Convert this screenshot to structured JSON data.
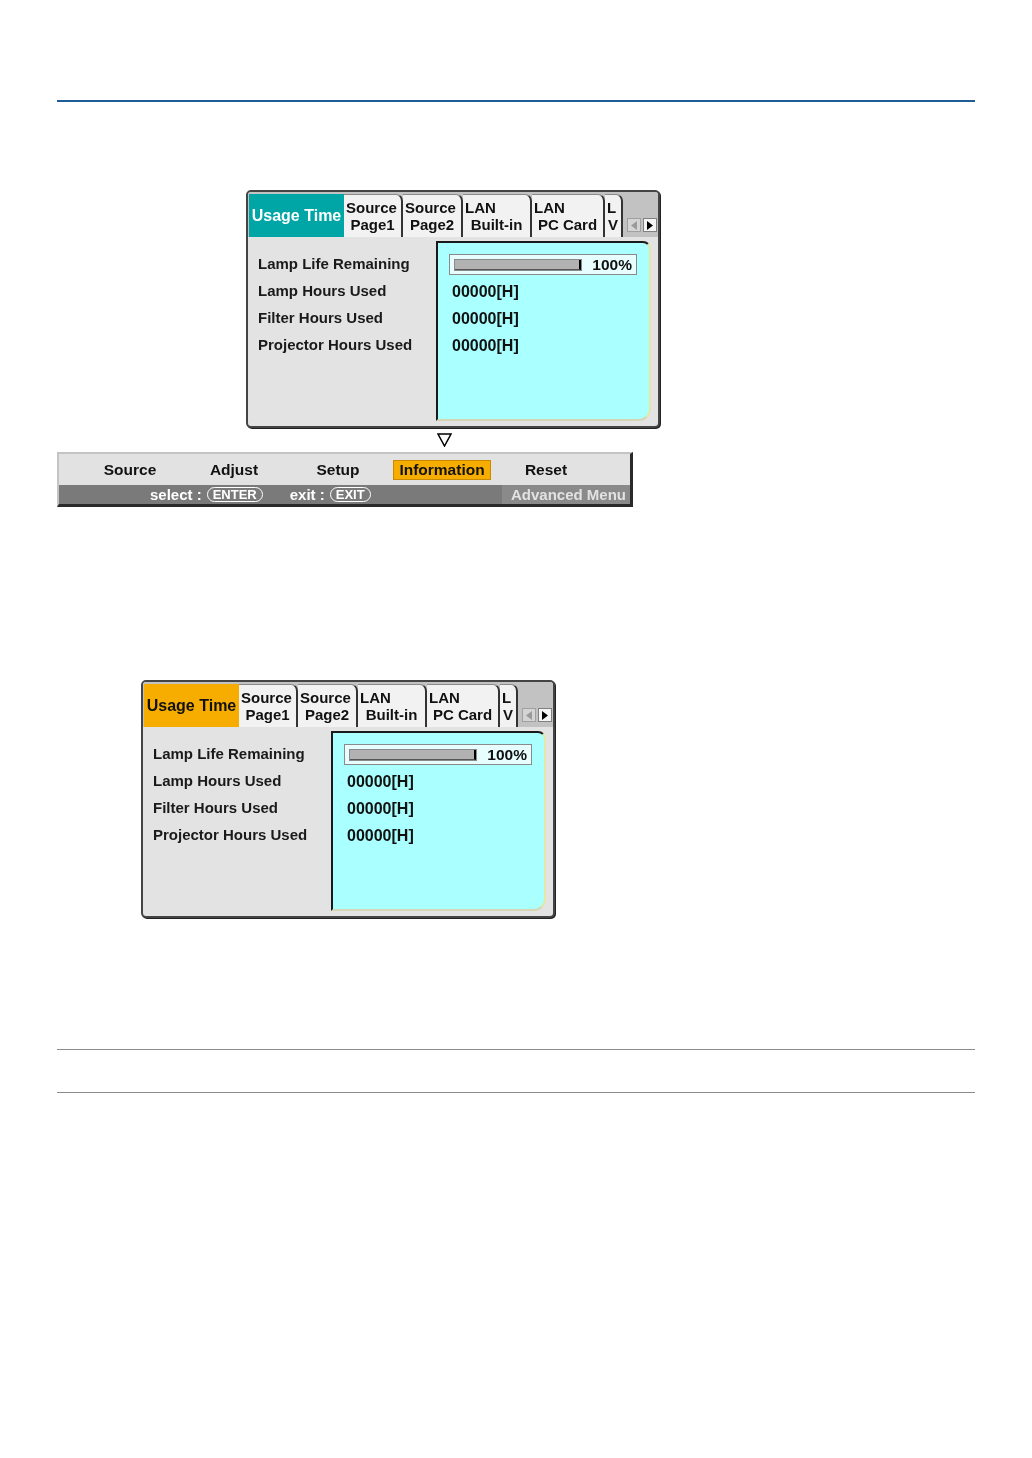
{
  "figures": [
    {
      "panel": {
        "tabs": [
          {
            "lines": [
              "Usage Time"
            ],
            "selected": true,
            "cursor": false
          },
          {
            "lines": [
              "Source",
              "Page1"
            ],
            "selected": false,
            "cursor": false
          },
          {
            "lines": [
              "Source",
              "Page2"
            ],
            "selected": false,
            "cursor": false
          },
          {
            "lines": [
              "LAN",
              "Built-in"
            ],
            "selected": false,
            "cursor": false
          },
          {
            "lines": [
              "LAN",
              "PC Card"
            ],
            "selected": false,
            "cursor": false
          },
          {
            "lines": [
              "L",
              "V"
            ],
            "selected": false,
            "cursor": false
          }
        ],
        "scroll_buttons": [
          {
            "kind": "left",
            "disabled": true
          },
          {
            "kind": "right",
            "disabled": false
          }
        ],
        "rows": [
          {
            "kind": "meter",
            "label": "Lamp Life Remaining",
            "level": 1,
            "reading": "100%"
          },
          {
            "kind": "text",
            "label": "Lamp Hours Used",
            "value": "00000[H]"
          },
          {
            "kind": "text",
            "label": "Filter Hours Used",
            "value": "00000[H]"
          },
          {
            "kind": "text",
            "label": "Projector Hours Used",
            "value": "00000[H]"
          }
        ]
      },
      "menu_bar": {
        "items": [
          {
            "label": "Source",
            "selected": false
          },
          {
            "label": "Adjust",
            "selected": false
          },
          {
            "label": "Setup",
            "selected": false
          },
          {
            "label": "Information",
            "selected": true
          },
          {
            "label": "Reset",
            "selected": false
          }
        ],
        "hints": [
          {
            "label": "select :",
            "key": "ENTER"
          },
          {
            "label": "exit :",
            "key": "EXIT"
          }
        ],
        "mode": "Advanced Menu"
      }
    },
    {
      "panel": {
        "tabs": [
          {
            "lines": [
              "Usage Time"
            ],
            "selected": true,
            "cursor": true
          },
          {
            "lines": [
              "Source",
              "Page1"
            ],
            "selected": false,
            "cursor": false
          },
          {
            "lines": [
              "Source",
              "Page2"
            ],
            "selected": false,
            "cursor": false
          },
          {
            "lines": [
              "LAN",
              "Built-in"
            ],
            "selected": false,
            "cursor": false
          },
          {
            "lines": [
              "LAN",
              "PC Card"
            ],
            "selected": false,
            "cursor": false
          },
          {
            "lines": [
              "L",
              "V"
            ],
            "selected": false,
            "cursor": false
          }
        ],
        "scroll_buttons": [
          {
            "kind": "left",
            "disabled": true
          },
          {
            "kind": "right",
            "disabled": false
          }
        ],
        "rows": [
          {
            "kind": "meter",
            "label": "Lamp Life Remaining",
            "level": 1,
            "reading": "100%"
          },
          {
            "kind": "text",
            "label": "Lamp Hours Used",
            "value": "00000[H]"
          },
          {
            "kind": "text",
            "label": "Filter Hours Used",
            "value": "00000[H]"
          },
          {
            "kind": "text",
            "label": "Projector Hours Used",
            "value": "00000[H]"
          }
        ]
      }
    }
  ]
}
